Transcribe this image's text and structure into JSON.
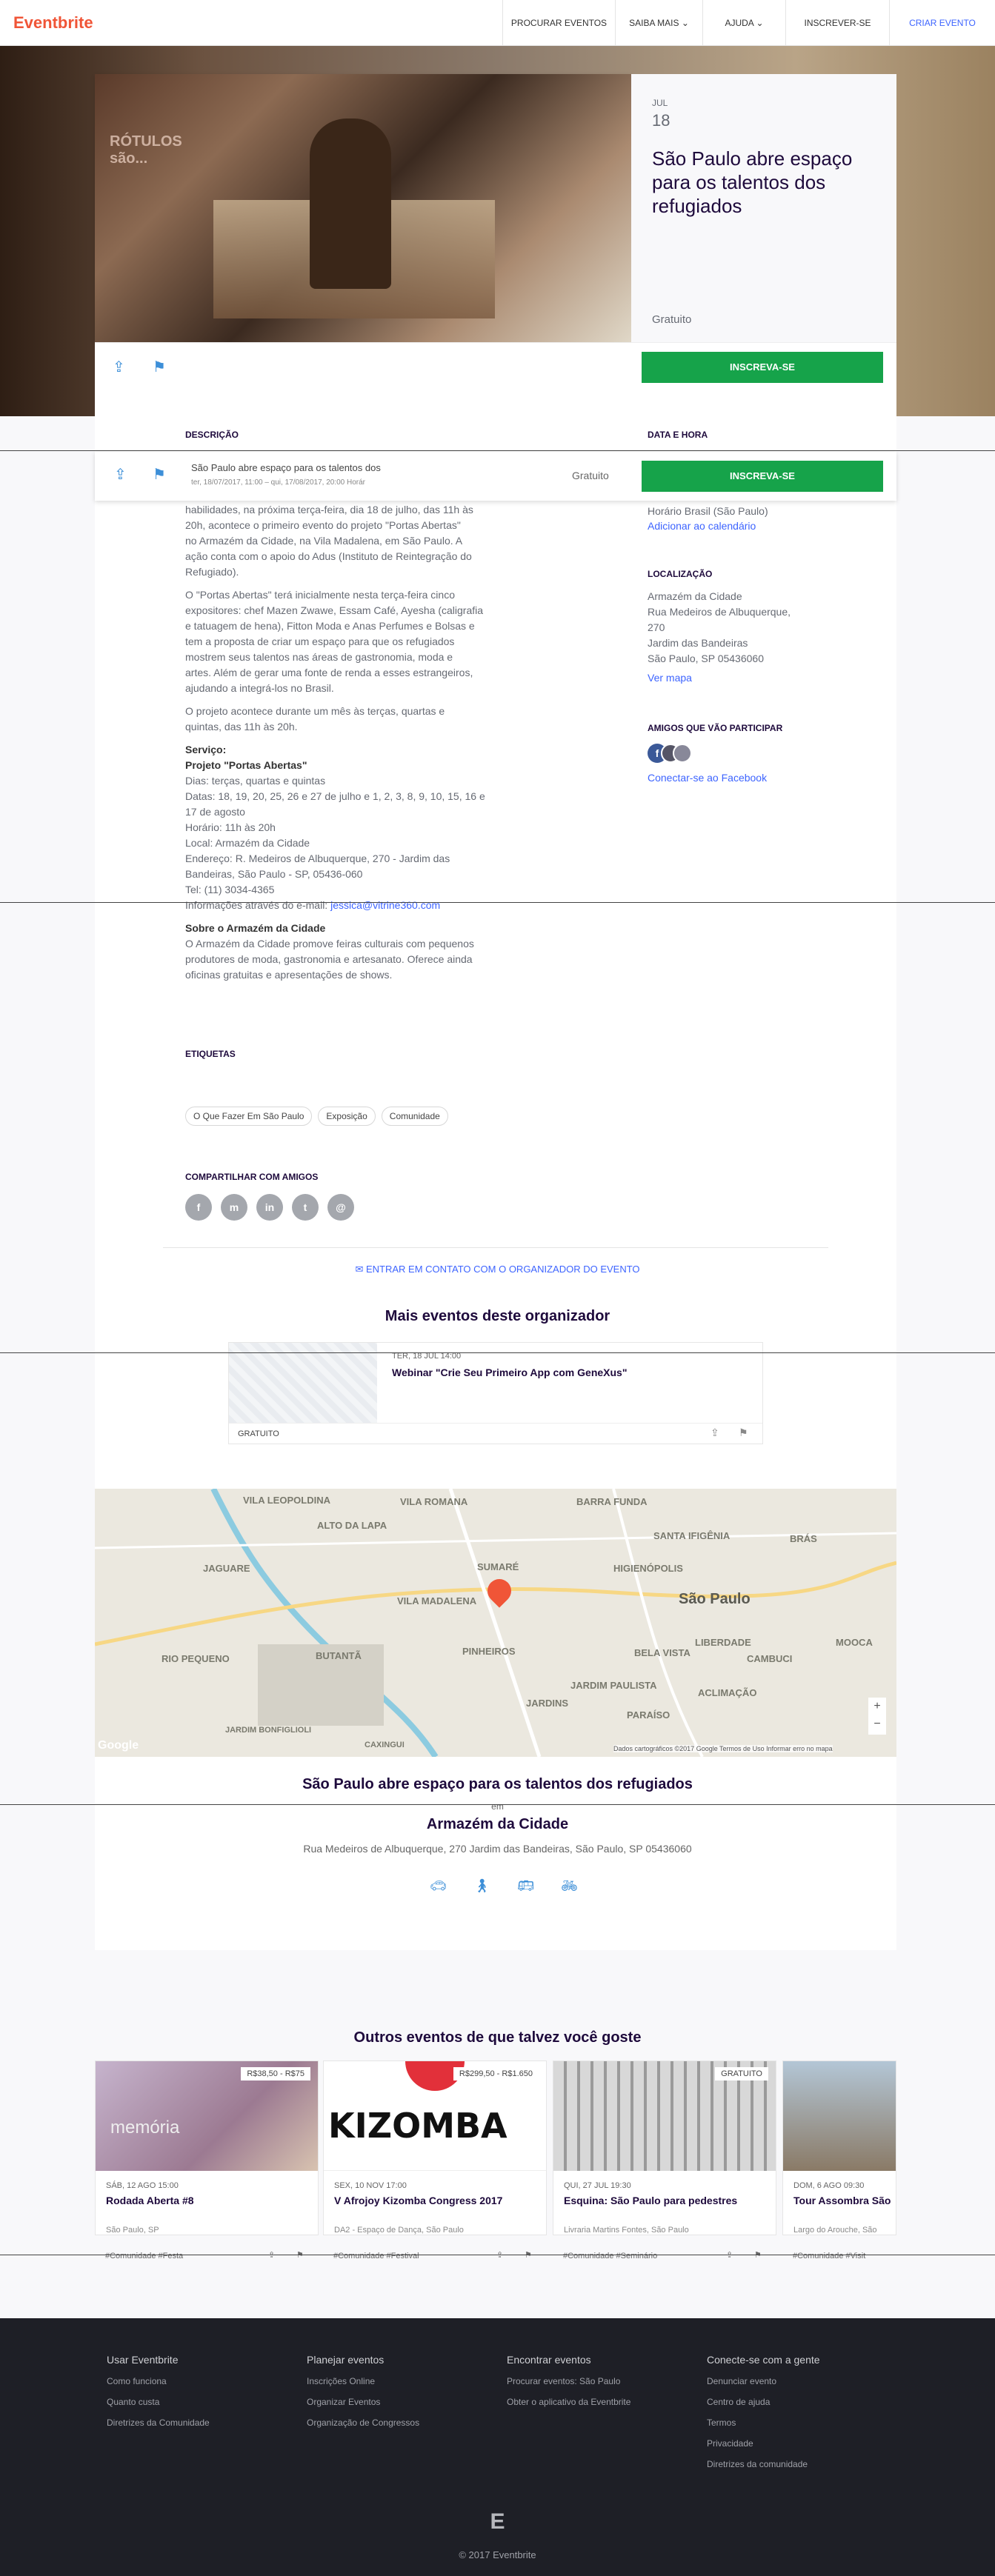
{
  "nav": {
    "logo": "Eventbrite",
    "items": [
      "PROCURAR EVENTOS",
      "SAIBA MAIS",
      "AJUDA",
      "INSCREVER-SE",
      "CRIAR EVENTO"
    ]
  },
  "event": {
    "month": "JUL",
    "day": "18",
    "title": "São Paulo abre espaço para os talentos dos refugiados",
    "price": "Gratuito",
    "register": "INSCREVA-SE"
  },
  "sticky": {
    "title": "São Paulo abre espaço para os talentos dos",
    "date": "ter, 18/07/2017, 11:00 – qui, 17/08/2017, 20:00 Horár",
    "price": "Gratuito",
    "register": "INSCREVA-SE"
  },
  "description": {
    "heading": "DESCRIÇÃO",
    "p1": [
      "habilidades, na próxima terça-feira, dia 18 de julho, das 11h às",
      "20h, acontece o primeiro evento do projeto \"Portas Abertas\"",
      "no Armazém da Cidade, na Vila Madalena, em São Paulo. A",
      "ação conta com o apoio do Adus (Instituto de Reintegração do",
      "Refugiado)."
    ],
    "p2": [
      "O \"Portas Abertas\" terá inicialmente nesta terça-feira cinco",
      "expositores: chef Mazen Zwawe, Essam Café, Ayesha (caligrafia",
      "e tatuagem de hena), Fitton Moda e Anas Perfumes e Bolsas e",
      "tem a proposta de criar um espaço para que os refugiados",
      "mostrem seus talentos nas áreas de gastronomia, moda e",
      "artes. Além de gerar uma fonte de renda a esses estrangeiros,",
      "ajudando a integrá-los no Brasil."
    ],
    "p3": [
      "O projeto acontece durante um mês às terças, quartas e",
      "quintas, das 11h às 20h."
    ],
    "service_title": "Serviço:",
    "project_title": "Projeto \"Portas Abertas\"",
    "service": [
      "Dias: terças, quartas e quintas",
      "Datas: 18, 19, 20, 25, 26 e 27 de julho e 1, 2, 3, 8, 9, 10, 15, 16 e",
      "17 de agosto",
      "Horário: 11h às 20h",
      "Local: Armazém da Cidade",
      "Endereço: R. Medeiros de Albuquerque, 270 - Jardim das",
      "Bandeiras, São Paulo - SP, 05436-060",
      "Tel: (11) 3034-4365"
    ],
    "email_prefix": "Informações através do e-mail: ",
    "email": "jessica@vitrine360.com",
    "about_title": "Sobre o Armazém da Cidade",
    "about": [
      "O Armazém da Cidade promove feiras culturais com pequenos",
      "produtores de moda, gastronomia e artesanato. Oferece ainda",
      "oficinas gratuitas e apresentações de shows."
    ]
  },
  "side": {
    "date_heading": "DATA E HORA",
    "timezone": "Horário Brasil (São Paulo)",
    "calendar": "Adicionar ao calendário",
    "loc_heading": "LOCALIZAÇÃO",
    "loc": [
      "Armazém da Cidade",
      "Rua Medeiros de Albuquerque,",
      "270",
      "Jardim das Bandeiras",
      "São Paulo, SP 05436060"
    ],
    "map_link": "Ver mapa",
    "friends_heading": "AMIGOS QUE VÃO PARTICIPAR",
    "facebook": "Conectar-se ao Facebook"
  },
  "tags": {
    "heading": "ETIQUETAS",
    "items": [
      "O Que Fazer Em São Paulo",
      "Exposição",
      "Comunidade"
    ]
  },
  "share": {
    "heading": "COMPARTILHAR COM AMIGOS",
    "icons": [
      "f",
      "m",
      "in",
      "t",
      "@"
    ]
  },
  "contact": "ENTRAR EM CONTATO COM O ORGANIZADOR DO EVENTO",
  "more": {
    "heading": "Mais eventos deste organizador",
    "date": "TER, 18 JUL 14:00",
    "title": "Webinar \"Crie Seu Primeiro App com GeneXus\"",
    "price": "GRATUITO"
  },
  "map": {
    "labels": [
      "VILA LEOPOLDINA",
      "VILA ROMANA",
      "BARRA FUNDA",
      "ALTO DA LAPA",
      "SANTA IFIGÊNIA",
      "BRÁS",
      "JAGUARE",
      "SUMARÉ",
      "HIGIENÓPOLIS",
      "VILA MADALENA",
      "São Paulo",
      "LIBERDADE",
      "MOOCA",
      "RIO PEQUENO",
      "BUTANTÃ",
      "PINHEIROS",
      "BELA VISTA",
      "CAMBUCI",
      "JARDIM PAULISTA",
      "ACLIMAÇÃO",
      "JARDINS",
      "PARAÍSO",
      "JARDIM BONFIGLIOLI",
      "CAXINGUI"
    ],
    "attribution": "Dados cartográficos ©2017 Google   Termos de Uso   Informar erro no mapa",
    "google": "Google"
  },
  "venue": {
    "title": "São Paulo abre espaço para os talentos dos refugiados",
    "at": "em",
    "name": "Armazém da Cidade",
    "address": "Rua Medeiros de Albuquerque, 270 Jardim das Bandeiras, São Paulo, SP 05436060"
  },
  "recommend": {
    "heading": "Outros eventos de que talvez você goste",
    "cards": [
      {
        "price": "R$38,50 - R$75",
        "date": "SÁB, 12 AGO 15:00",
        "title": "Rodada Aberta #8",
        "place": "São Paulo, SP",
        "tags": "#Comunidade   #Festa",
        "img_text": "memória"
      },
      {
        "price": "R$299,50 - R$1.650",
        "date": "SEX, 10 NOV 17:00",
        "title": "V Afrojoy Kizomba Congress 2017",
        "place": "DA2 - Espaço de Dança, São Paulo",
        "tags": "#Comunidade   #Festival",
        "img_text": "KIZOMBA"
      },
      {
        "price": "GRATUITO",
        "date": "QUI, 27 JUL 19:30",
        "title": "Esquina: São Paulo para pedestres",
        "place": "Livraria Martins Fontes, São Paulo",
        "tags": "#Comunidade   #Seminário",
        "img_text": ""
      },
      {
        "price": "",
        "date": "DOM, 6 AGO 09:30",
        "title": "Tour Assombra São",
        "place": "Largo do Arouche, São",
        "tags": "#Comunidade   #Visit",
        "img_text": ""
      }
    ]
  },
  "footer": {
    "cols": [
      {
        "title": "Usar Eventbrite",
        "links": [
          "Como funciona",
          "Quanto custa",
          "Diretrizes da Comunidade"
        ]
      },
      {
        "title": "Planejar eventos",
        "links": [
          "Inscrições Online",
          "Organizar Eventos",
          "Organização de Congressos"
        ]
      },
      {
        "title": "Encontrar eventos",
        "links": [
          "Procurar eventos: São Paulo",
          "Obter o aplicativo da Eventbrite"
        ]
      },
      {
        "title": "Conecte-se com a gente",
        "links": [
          "Denunciar evento",
          "Centro de ajuda",
          "Termos",
          "Privacidade",
          "Diretrizes da comunidade"
        ]
      }
    ],
    "logo": "E",
    "copyright": "© 2017 Eventbrite"
  }
}
